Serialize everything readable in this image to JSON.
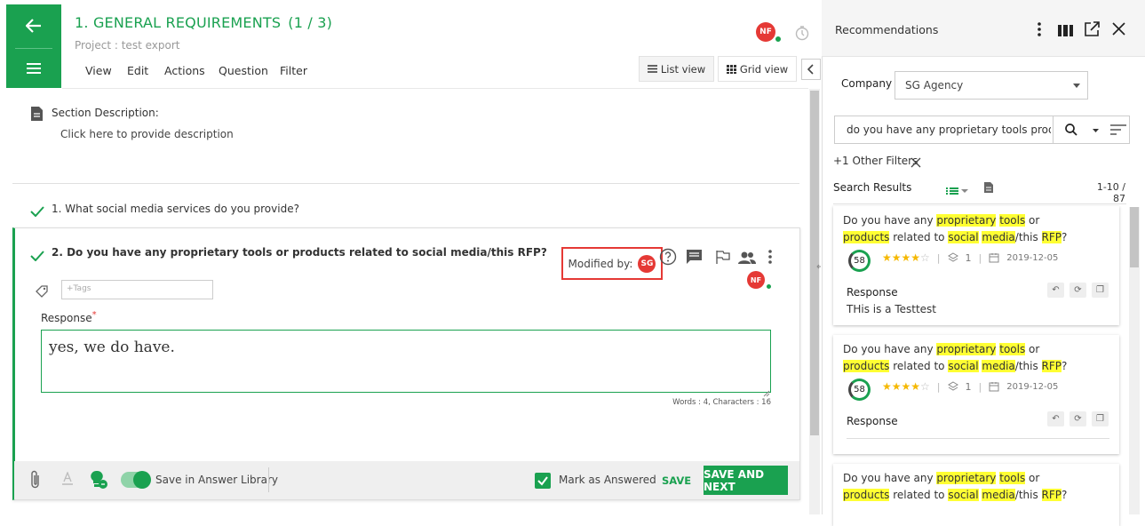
{
  "header": {
    "title": "1. GENERAL REQUIREMENTS",
    "progress": "(1 / 3)",
    "project": "Project : test export",
    "menu": [
      "View",
      "Edit",
      "Actions",
      "Question",
      "Filter"
    ],
    "list_view": "List view",
    "grid_view": "Grid view",
    "user_initials": "NF"
  },
  "section": {
    "label": "Section Description:",
    "placeholder": "Click here to provide description"
  },
  "questions": [
    {
      "text": "1. What social media services do you provide?"
    },
    {
      "text": "2. Do you have any proprietary tools or products related to social media/this RFP?"
    }
  ],
  "editor": {
    "modified_by_label": "Modified by:",
    "modified_by_initials": "SG",
    "assignee_initials": "NF",
    "tags_placeholder": "+Tags",
    "response_label": "Response",
    "required_mark": "*",
    "response_value": "yes, we do have.",
    "counts": "Words : 4, Characters : 16",
    "save_library_label": "Save in Answer Library",
    "mark_answered_label": "Mark as Answered",
    "save_label": "SAVE",
    "save_next_label": "SAVE AND NEXT"
  },
  "recommendations": {
    "title": "Recommendations",
    "company_label": "Company",
    "company_value": "SG Agency",
    "search_value": "do you have any proprietary tools produc",
    "other_filters": "+1 Other Filters",
    "results_label": "Search Results",
    "results_count": "1-10 / 87",
    "cards": [
      {
        "score": "58",
        "rating": 4,
        "versions": "1",
        "date": "2019-12-05",
        "response_label": "Response",
        "response_text": "THis is a Testtest"
      },
      {
        "score": "58",
        "rating": 4,
        "versions": "1",
        "date": "2019-12-05",
        "response_label": "Response",
        "response_text": ""
      },
      {
        "score": "",
        "rating": 0,
        "versions": "",
        "date": "",
        "response_label": "",
        "response_text": ""
      }
    ],
    "card_question": {
      "p1": "Do you have any ",
      "h1": "proprietary",
      "s1": " ",
      "h2": "tools",
      "p2": " or",
      "h3": "products",
      "p3": " related to ",
      "h4": "social",
      "s2": " ",
      "h5": "media",
      "p4": "/this ",
      "h6": "RFP",
      "p5": "?"
    }
  },
  "colors": {
    "brand_green": "#1aa150",
    "avatar_red": "#e53935",
    "highlight": "#ffff33",
    "highlight_box": "#e53935"
  }
}
